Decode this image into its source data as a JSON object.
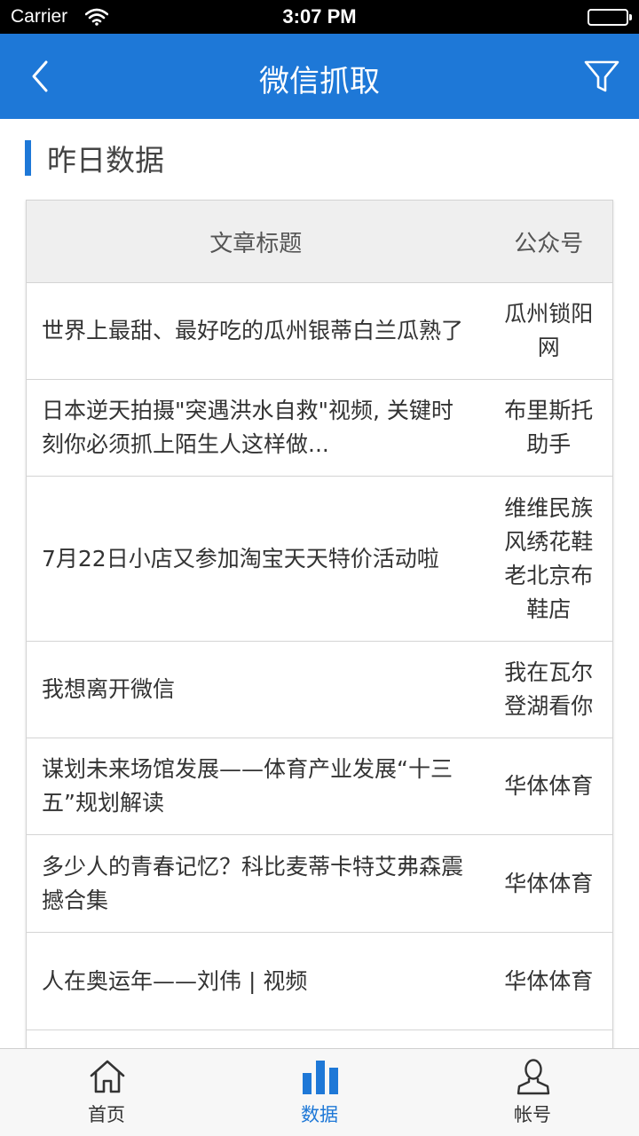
{
  "status_bar": {
    "carrier": "Carrier",
    "time": "3:07 PM"
  },
  "nav": {
    "title": "微信抓取",
    "back_icon": "chevron-left-icon",
    "filter_icon": "filter-icon"
  },
  "section": {
    "title": "昨日数据"
  },
  "table": {
    "headers": {
      "title": "文章标题",
      "account": "公众号"
    },
    "rows": [
      {
        "title": "世界上最甜、最好吃的瓜州银蒂白兰瓜熟了",
        "account": "瓜州锁阳网"
      },
      {
        "title": "日本逆天拍摄\"突遇洪水自救\"视频, 关键时刻你必须抓上陌生人这样做...",
        "account": "布里斯托助手"
      },
      {
        "title": "7月22日小店又参加淘宝天天特价活动啦",
        "account": "维维民族风绣花鞋老北京布鞋店"
      },
      {
        "title": "我想离开微信",
        "account": "我在瓦尔登湖看你"
      },
      {
        "title": "谋划未来场馆发展——体育产业发展“十三五”规划解读",
        "account": "华体体育"
      },
      {
        "title": "多少人的青春记忆？科比麦蒂卡特艾弗森震撼合集",
        "account": "华体体育"
      },
      {
        "title": "人在奥运年——刘伟 | 视频",
        "account": "华体体育"
      },
      {
        "title": "",
        "account": ""
      }
    ]
  },
  "tabs": [
    {
      "label": "首页",
      "icon": "home-icon",
      "active": false
    },
    {
      "label": "数据",
      "icon": "bar-chart-icon",
      "active": true
    },
    {
      "label": "帐号",
      "icon": "user-icon",
      "active": false
    }
  ],
  "colors": {
    "accent": "#1e78d7",
    "header_bg": "#efefef"
  }
}
